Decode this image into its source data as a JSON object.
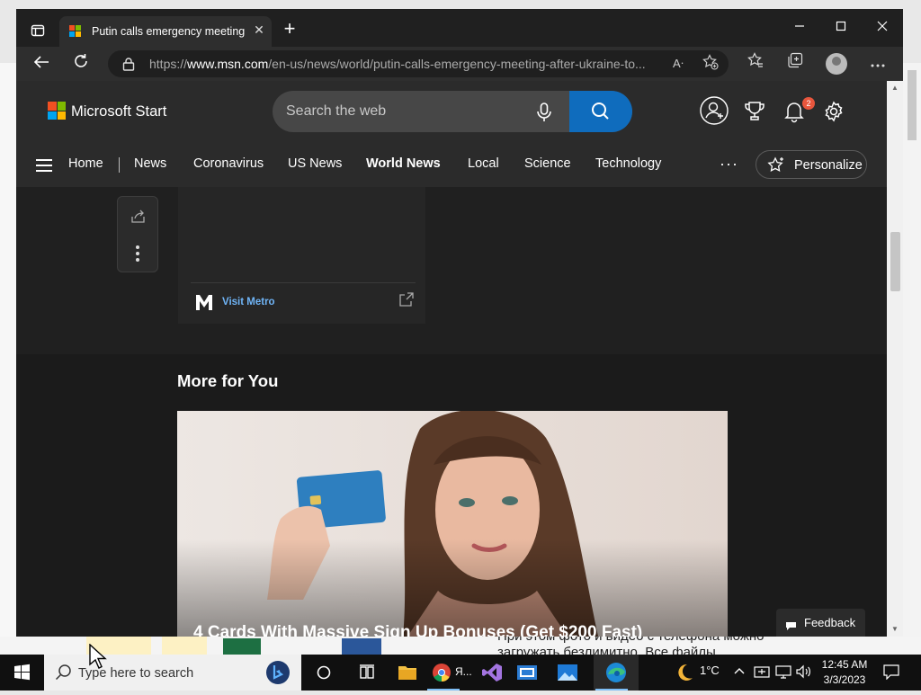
{
  "tab": {
    "title": "Putin calls emergency meeting after Ukraine to",
    "close": "✕",
    "new": "+"
  },
  "window_controls": {
    "minimize": "—",
    "maximize": "☐",
    "close": "✕"
  },
  "address": {
    "url_prefix": "https://",
    "url_domain": "www.msn.com",
    "url_rest": "/en-us/news/world/putin-calls-emergency-meeting-after-ukraine-to...",
    "read_aloud": "Aᐧ"
  },
  "header": {
    "brand": "Microsoft Start",
    "search_placeholder": "Search the web",
    "notification_count": "2"
  },
  "nav": {
    "items": [
      "Home",
      "News",
      "Coronavirus",
      "US News",
      "World News",
      "Local",
      "Science",
      "Technology"
    ],
    "more": "···",
    "personalize": "Personalize"
  },
  "article": {
    "visit_label": "Visit Metro",
    "more_for_you": "More for You",
    "promo_title": "4 Cards With Massive Sign Up Bonuses (Get $200 Fast)"
  },
  "feedback": "Feedback",
  "background_text": "При этом фото и видео с телефона можно загружать безлимитно. Все файлы",
  "taskbar": {
    "search_placeholder": "Type here to search",
    "chrome_label": "Я...",
    "weather": "1°C",
    "time": "12:45 AM",
    "date": "3/3/2023"
  },
  "colors": {
    "accent": "#0f6cbd",
    "page_bg": "#1b1b1b",
    "header_bg": "#2b2b2b",
    "link": "#6fb4f6",
    "badge": "#e8563d"
  }
}
